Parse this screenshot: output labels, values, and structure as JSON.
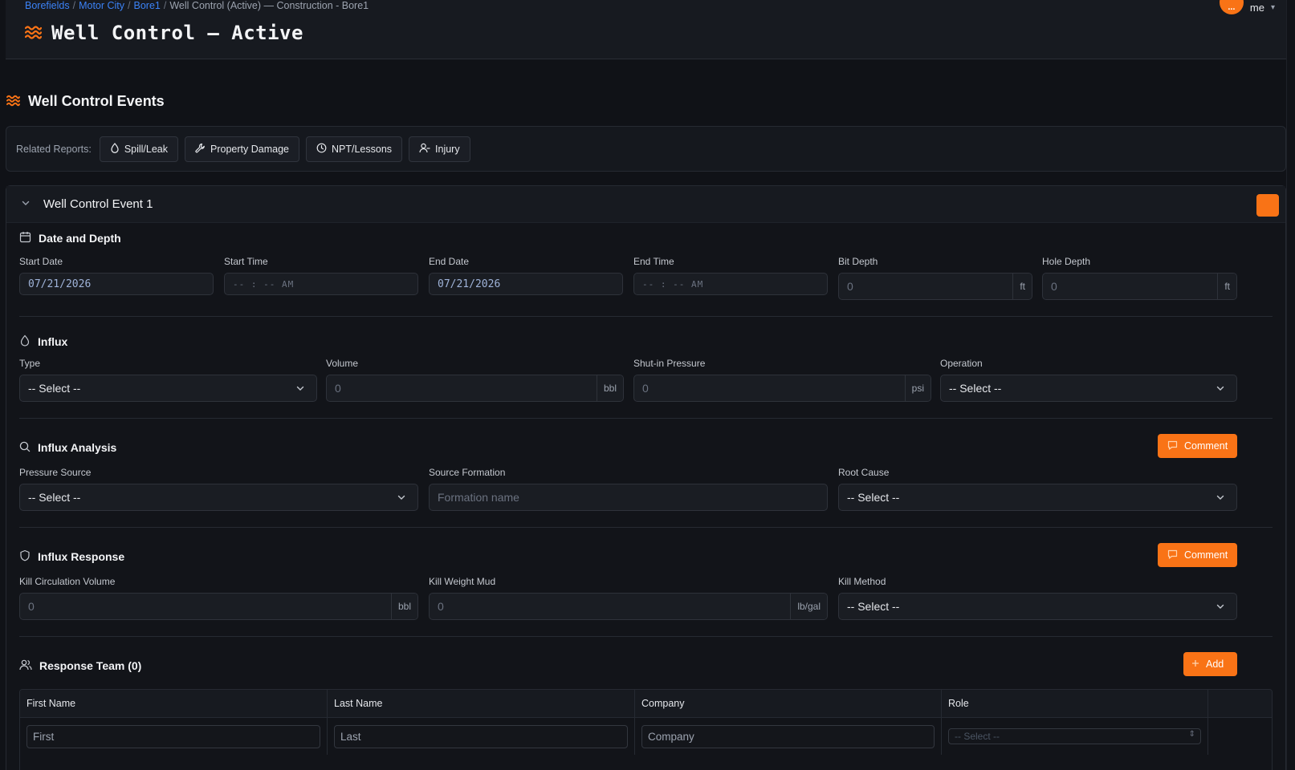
{
  "header": {
    "breadcrumb": {
      "crumb1": "Borefields",
      "crumb2": "Motor City",
      "crumb3": "Bore1",
      "current": "Well Control (Active) — Construction - Bore1",
      "separator": "/"
    },
    "title": "Well Control — Active",
    "user": {
      "avatar_initials": "...",
      "name": "me"
    }
  },
  "section": {
    "title": "Well Control Events"
  },
  "related_reports": {
    "label": "Related Reports:",
    "spill": "Spill/Leak",
    "property": "Property Damage",
    "npt": "NPT/Lessons",
    "injury": "Injury"
  },
  "event": {
    "title": "Well Control Event 1",
    "date_depth": {
      "title": "Date and Depth",
      "start_date_label": "Start Date",
      "start_date_value": "07/21/2026",
      "start_time_label": "Start Time",
      "start_time_value": "-- : --  AM",
      "end_date_label": "End Date",
      "end_date_value": "07/21/2026",
      "end_time_label": "End Time",
      "end_time_value": "-- : --  AM",
      "bit_depth_label": "Bit Depth",
      "bit_depth_placeholder": "0",
      "bit_depth_unit": "ft",
      "hole_depth_label": "Hole Depth",
      "hole_depth_placeholder": "0",
      "hole_depth_unit": "ft"
    },
    "influx": {
      "title": "Influx",
      "type_label": "Type",
      "type_value": "-- Select --",
      "volume_label": "Volume",
      "volume_placeholder": "0",
      "volume_unit": "bbl",
      "sip_label": "Shut-in Pressure",
      "sip_placeholder": "0",
      "sip_unit": "psi",
      "operation_label": "Operation",
      "operation_value": "-- Select --"
    },
    "analysis": {
      "title": "Influx Analysis",
      "comment": "Comment",
      "pressure_source_label": "Pressure Source",
      "pressure_source_value": "-- Select --",
      "formation_label": "Source Formation",
      "formation_placeholder": "Formation name",
      "root_cause_label": "Root Cause",
      "root_cause_value": "-- Select --"
    },
    "response": {
      "title": "Influx Response",
      "comment": "Comment",
      "kcv_label": "Kill Circulation Volume",
      "kcv_placeholder": "0",
      "kcv_unit": "bbl",
      "kwm_label": "Kill Weight Mud",
      "kwm_placeholder": "0",
      "kwm_unit": "lb/gal",
      "kill_method_label": "Kill Method",
      "kill_method_value": "-- Select --"
    },
    "team": {
      "title": "Response Team (0)",
      "add": "Add",
      "columns": {
        "first": "First Name",
        "last": "Last Name",
        "company": "Company",
        "role": "Role"
      },
      "row": {
        "first": "First",
        "last": "Last",
        "company": "Company",
        "role": "-- Select --"
      }
    }
  },
  "colors": {
    "accent": "#f97316",
    "link": "#3b82f6",
    "background": "#101217"
  }
}
